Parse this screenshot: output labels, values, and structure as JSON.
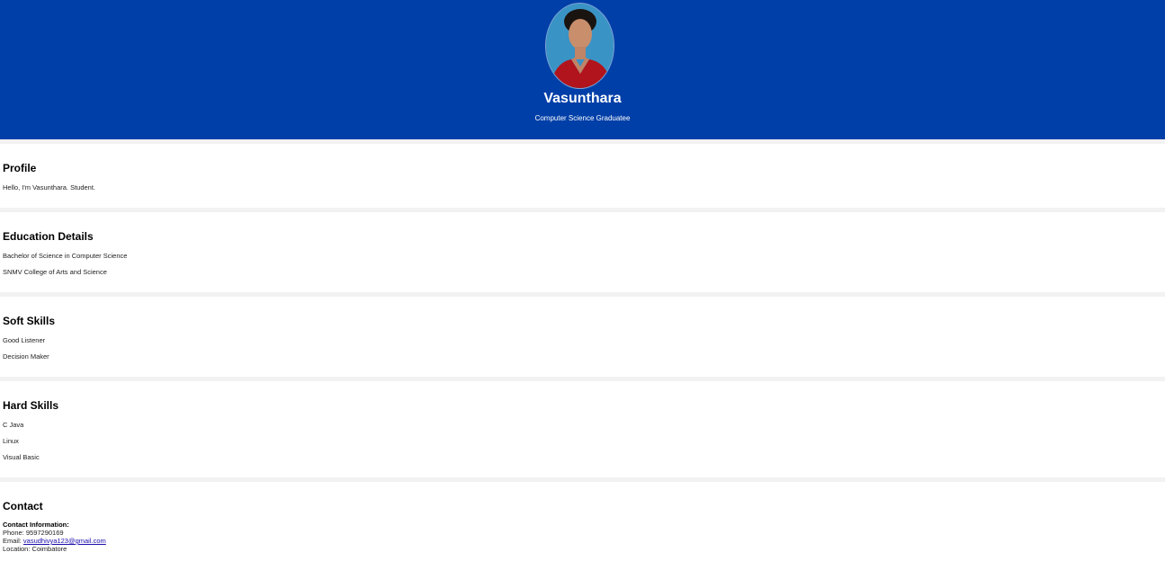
{
  "header": {
    "name": "Vasunthara",
    "subtitle": "Computer Science Graduatee"
  },
  "profile": {
    "title": "Profile",
    "text": "Hello, I'm Vasunthara. Student."
  },
  "education": {
    "title": "Education Details",
    "items": [
      "Bachelor of Science in Computer Science",
      "SNMV College of Arts and Science"
    ]
  },
  "soft_skills": {
    "title": "Soft Skills",
    "items": [
      "Good Listener",
      "Decision Maker"
    ]
  },
  "hard_skills": {
    "title": "Hard Skills",
    "items": [
      "C Java",
      "Linux",
      "Visual Basic"
    ]
  },
  "contact": {
    "title": "Contact",
    "heading": "Contact Information:",
    "phone_label": "Phone: ",
    "phone": "9597290169",
    "email_label": "Email: ",
    "email": "vasudhivya123@gmail.com",
    "location_label": "Location: ",
    "location": "Coimbatore"
  }
}
